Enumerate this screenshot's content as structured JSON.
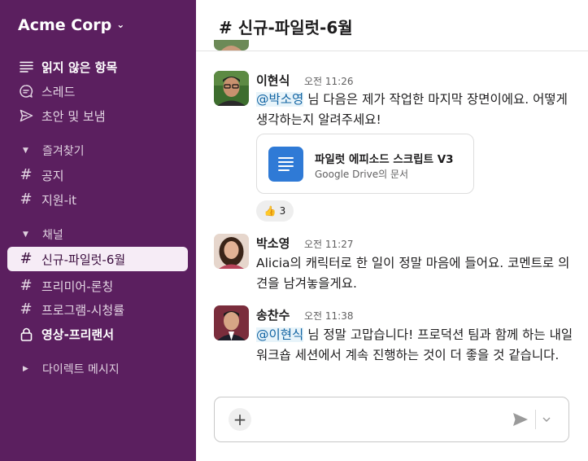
{
  "sidebar": {
    "workspace": "Acme Corp",
    "top_items": [
      {
        "label": "읽지 않은 항목",
        "icon": "unread-list-icon"
      },
      {
        "label": "스레드",
        "icon": "threads-icon"
      },
      {
        "label": "초안 및 보냄",
        "icon": "send-icon"
      }
    ],
    "favorites": {
      "title": "즐겨찾기",
      "channels": [
        "공지",
        "지원-it"
      ]
    },
    "channels_section": {
      "title": "채널",
      "channels": [
        "신규-파일럿-6월",
        "프리미어-론칭",
        "프로그램-시청률",
        "영상-프리랜서"
      ]
    },
    "dm_section": {
      "title": "다이렉트 메시지"
    }
  },
  "channel": {
    "hash": "#",
    "name": "신규-파일럿-6월"
  },
  "messages": [
    {
      "name": "이현식",
      "time": "오전 11:26",
      "mention": "@박소영",
      "text_after_mention": " 님 다음은 제가 작업한 마지막 장면이에요. 어떻게 생각하는지 알려주세요!",
      "attachment": {
        "title": "파일럿 에피소드 스크립트 V3",
        "subtitle": "Google Drive의 문서"
      },
      "reaction": {
        "emoji": "👍",
        "count": "3"
      }
    },
    {
      "name": "박소영",
      "time": "오전 11:27",
      "text": "Alicia의 캐릭터로 한 일이 정말 마음에 들어요. 코멘트로 의견을 남겨놓을게요."
    },
    {
      "name": "송찬수",
      "time": "오전 11:38",
      "mention": "@이현식",
      "text_after_mention": " 님 정말 고맙습니다! 프로덕션 팀과 함께 하는 내일 워크숍 세션에서 계속 진행하는 것이 더 좋을 것 같습니다."
    }
  ],
  "composer": {
    "plus": "+"
  },
  "colors": {
    "sidebar_bg": "#5b1f5f",
    "mention_bg": "#e8f4fa",
    "mention_text": "#1264a3",
    "file_icon": "#2f7ad6"
  }
}
